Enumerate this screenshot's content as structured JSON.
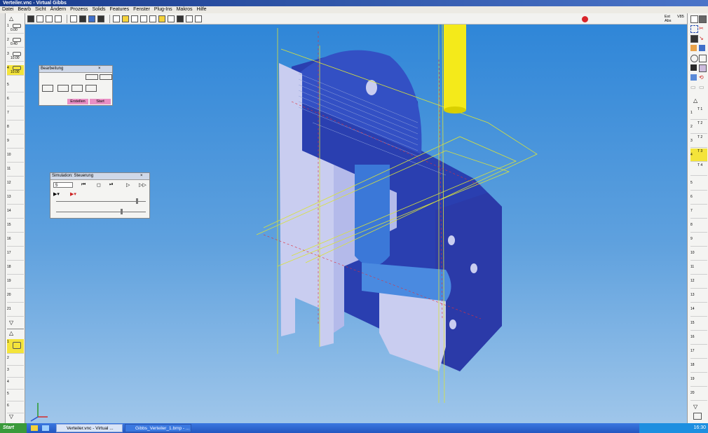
{
  "window": {
    "title": "Verteiler.vnc - Virtual Gibbs"
  },
  "menu": [
    "Datei",
    "Bearb",
    "Sicht",
    "Ändern",
    "Prozess",
    "Solids",
    "Features",
    "Fenster",
    "Plug-Ins",
    "Makros",
    "Hilfe"
  ],
  "toolbar_right": {
    "line1": "Ext",
    "line2": "Abs",
    "line3": "V85"
  },
  "left_slots": [
    {
      "n": "1",
      "v": "0.00"
    },
    {
      "n": "2",
      "v": "0.40"
    },
    {
      "n": "3",
      "v": "10.00"
    },
    {
      "n": "4",
      "v": "10.00",
      "active": true
    },
    {
      "n": "5",
      "v": ""
    },
    {
      "n": "6",
      "v": ""
    },
    {
      "n": "7",
      "v": ""
    },
    {
      "n": "8",
      "v": ""
    },
    {
      "n": "9",
      "v": ""
    },
    {
      "n": "10",
      "v": ""
    },
    {
      "n": "11",
      "v": ""
    },
    {
      "n": "12",
      "v": ""
    },
    {
      "n": "13",
      "v": ""
    },
    {
      "n": "14",
      "v": ""
    },
    {
      "n": "15",
      "v": ""
    },
    {
      "n": "16",
      "v": ""
    },
    {
      "n": "17",
      "v": ""
    },
    {
      "n": "18",
      "v": ""
    },
    {
      "n": "19",
      "v": ""
    },
    {
      "n": "20",
      "v": ""
    },
    {
      "n": "21",
      "v": ""
    }
  ],
  "left_lower": [
    {
      "n": "1",
      "v": "",
      "active": true
    },
    {
      "n": "2",
      "v": ""
    },
    {
      "n": "3",
      "v": ""
    },
    {
      "n": "4",
      "v": ""
    },
    {
      "n": "5",
      "v": ""
    },
    {
      "n": "6",
      "v": ""
    }
  ],
  "right_tools": [
    {
      "n": "T 1",
      "side": "1"
    },
    {
      "n": "T 2",
      "side": "2"
    },
    {
      "n": "T 2",
      "side": "3"
    },
    {
      "n": "T 3",
      "side": "4",
      "active": true
    },
    {
      "n": "T 4",
      "side": ""
    }
  ],
  "right_slots": [
    "5",
    "6",
    "7",
    "8",
    "9",
    "10",
    "11",
    "12",
    "13",
    "14",
    "15",
    "16",
    "17",
    "18",
    "19",
    "20"
  ],
  "palette_bearbeitung": {
    "title": "Bearbeitung",
    "btn_erstellen": "Erstellen",
    "btn_start": "Start"
  },
  "palette_simulation": {
    "title": "Simulation: Steuerung",
    "step_value": "5"
  },
  "taskbar": {
    "start": "Start",
    "tasks": [
      "Verteiler.vnc - Virtual ...",
      "Gibbs_Verteiler_1.bmp - ..."
    ],
    "clock": "16:30"
  },
  "colors": {
    "viewport_top": "#2f86d8",
    "viewport_bottom": "#9fc6ea",
    "part": "#2a3fb0",
    "part_light": "#c9cdf0",
    "tool": "#f4ea1a"
  }
}
